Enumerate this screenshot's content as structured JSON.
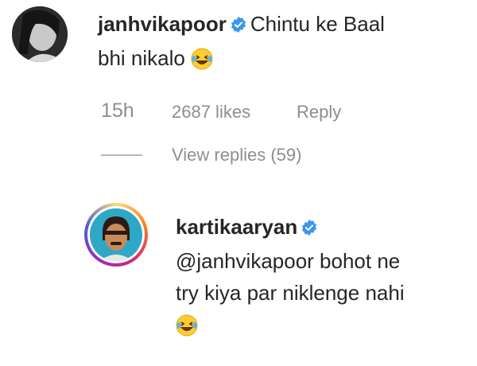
{
  "comment": {
    "username": "janhvikapoor",
    "text_line1": "Chintu ke Baal",
    "text_line2": "bhi nikalo",
    "emoji": "laughing-tears-emoji",
    "time": "15h",
    "likes": "2687 likes",
    "reply_label": "Reply",
    "view_replies": "View replies (59)"
  },
  "reply": {
    "username": "kartikaaryan",
    "mention": "@janhvikapoor",
    "text_line1_rest": " bohot ne",
    "text_line2": "try kiya par niklenge nahi",
    "emoji": "laughing-tears-emoji"
  },
  "colors": {
    "verified": "#3897f0",
    "muted_text": "#8e8e8e",
    "primary_text": "#262626",
    "emoji_face": "#ffcc33"
  }
}
